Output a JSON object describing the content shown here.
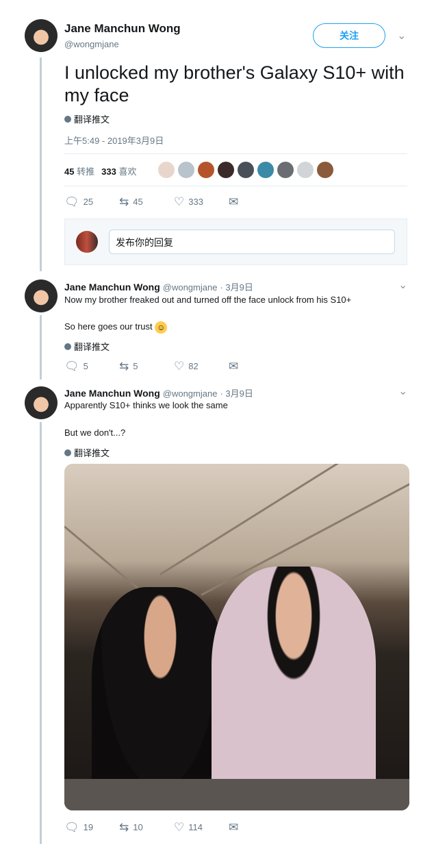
{
  "main_tweet": {
    "author_name": "Jane Manchun Wong",
    "author_handle": "@wongmjane",
    "follow_label": "关注",
    "text": "I unlocked my brother's Galaxy S10+ with my face",
    "translate_label": "翻译推文",
    "timestamp": "上午5:49 - 2019年3月9日",
    "retweets_count": "45",
    "retweets_label": "转推",
    "likes_count": "333",
    "likes_label": "喜欢",
    "reply_count": "25",
    "retweet_action_count": "45",
    "like_action_count": "333",
    "reply_placeholder": "发布你的回复"
  },
  "reply_1": {
    "author_name": "Jane Manchun Wong",
    "author_handle": "@wongmjane",
    "date": "· 3月9日",
    "line1": "Now my brother freaked out and turned off the face unlock from his S10+",
    "line2": "So here goes our trust",
    "translate_label": "翻译推文",
    "reply_count": "5",
    "retweet_count": "5",
    "like_count": "82"
  },
  "reply_2": {
    "author_name": "Jane Manchun Wong",
    "author_handle": "@wongmjane",
    "date": "· 3月9日",
    "line1": "Apparently S10+ thinks we look the same",
    "line2": "But we don't...?",
    "translate_label": "翻译推文",
    "reply_count": "19",
    "retweet_count": "10",
    "like_count": "114"
  },
  "colors": {
    "accent": "#1da1f2",
    "muted": "#657786",
    "text": "#14171a"
  }
}
